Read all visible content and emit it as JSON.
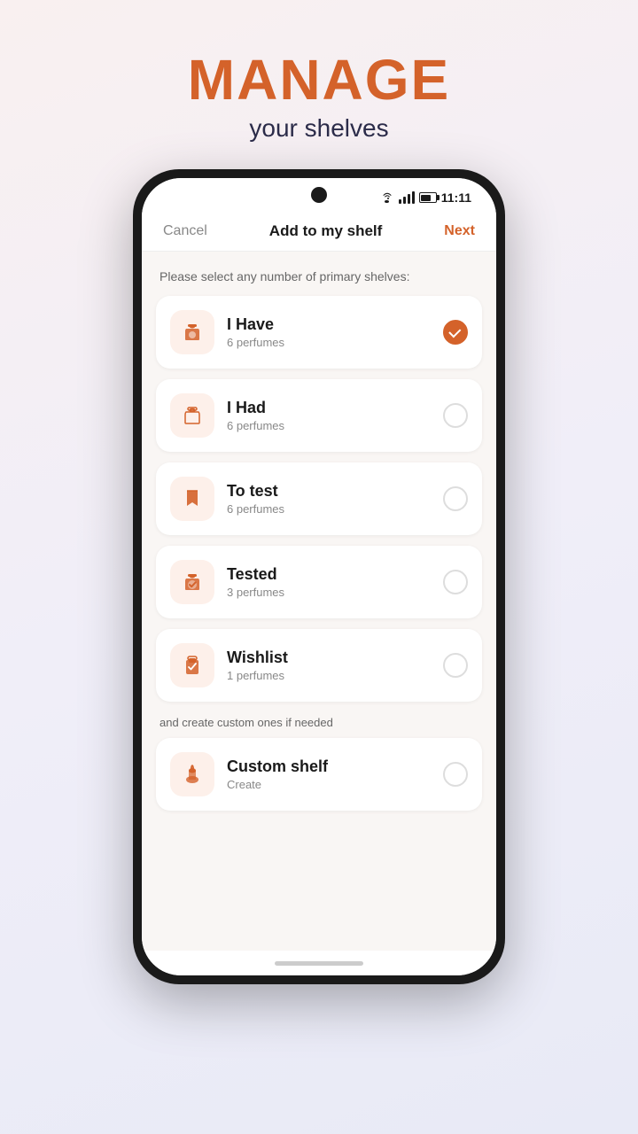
{
  "header": {
    "title_main": "MANAGE",
    "title_sub": "your shelves"
  },
  "statusBar": {
    "time": "11:11"
  },
  "nav": {
    "cancel_label": "Cancel",
    "title_label": "Add to my shelf",
    "next_label": "Next"
  },
  "content": {
    "primary_label": "Please select any number of primary shelves:",
    "custom_label": "and create custom ones if needed",
    "shelves": [
      {
        "id": "i-have",
        "name": "I Have",
        "count": "6 perfumes",
        "icon": "bottle",
        "checked": true
      },
      {
        "id": "i-had",
        "name": "I Had",
        "count": "6 perfumes",
        "icon": "bottle-outline",
        "checked": false
      },
      {
        "id": "to-test",
        "name": "To test",
        "count": "6 perfumes",
        "icon": "bookmark",
        "checked": false
      },
      {
        "id": "tested",
        "name": "Tested",
        "count": "3 perfumes",
        "icon": "bottle-check",
        "checked": false
      },
      {
        "id": "wishlist",
        "name": "Wishlist",
        "count": "1 perfumes",
        "icon": "gift",
        "checked": false
      }
    ],
    "custom_shelves": [
      {
        "id": "custom-shelf",
        "name": "Custom shelf",
        "count": "Create",
        "icon": "bottle-spray",
        "checked": false
      }
    ]
  }
}
